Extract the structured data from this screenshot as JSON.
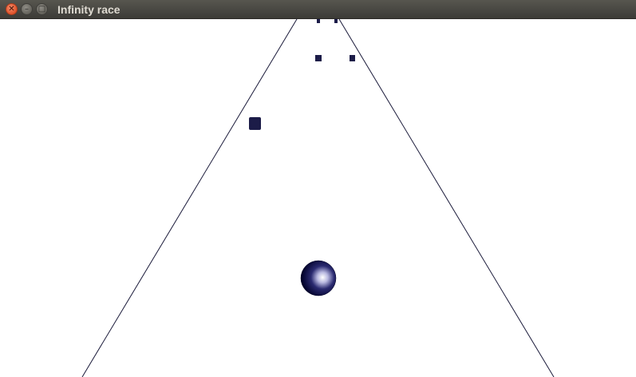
{
  "window": {
    "title": "Infinity race",
    "controls": {
      "close_icon": "✕",
      "minimize_icon": "–",
      "maximize_icon": "□"
    }
  },
  "game": {
    "colors": {
      "background": "#ffffff",
      "road_edge": "#1a1a3a",
      "obstacle": "#1c1c48",
      "ball_dark": "#000033",
      "ball_highlight": "#ffffff"
    },
    "obstacles_visible": 5,
    "player": "sphere"
  }
}
